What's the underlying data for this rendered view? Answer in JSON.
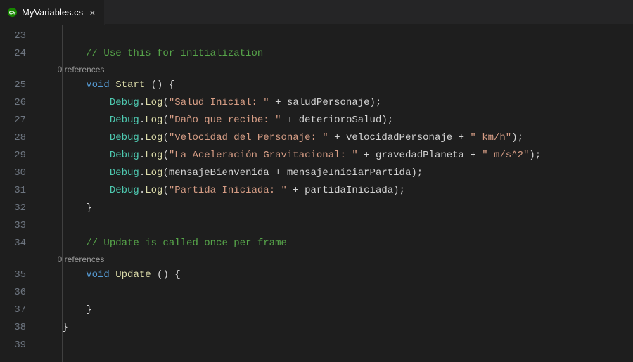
{
  "tab": {
    "filename": "MyVariables.cs",
    "close_label": "×"
  },
  "gutter": {
    "start": 23,
    "end": 39
  },
  "codelens": {
    "references": "0 references"
  },
  "code": {
    "comment_init": "// Use this for initialization",
    "comment_update": "// Update is called once per frame",
    "kw_void": "void",
    "fn_start": "Start",
    "fn_update": "Update",
    "paren_open_brace": " () {",
    "debug": "Debug",
    "log": "Log",
    "plus": " + ",
    "semicolon": ");",
    "close_brace": "}",
    "dot": ".",
    "open": "(",
    "s1": "\"Salud Inicial: \"",
    "v1": "saludPersonaje",
    "s2": "\"Daño que recibe: \"",
    "v2": "deterioroSalud",
    "s3": "\"Velocidad del Personaje: \"",
    "v3": "velocidadPersonaje",
    "s3b": "\" km/h\"",
    "s4": "\"La Aceleración Gravitacional: \"",
    "v4": "gravedadPlaneta",
    "s4b": "\" m/s^2\"",
    "v5a": "mensajeBienvenida",
    "v5b": "mensajeIniciarPartida",
    "s6": "\"Partida Iniciada: \"",
    "v6": "partidaIniciada"
  },
  "indent": {
    "l1": "    ",
    "l2": "        ",
    "l3": "            "
  }
}
